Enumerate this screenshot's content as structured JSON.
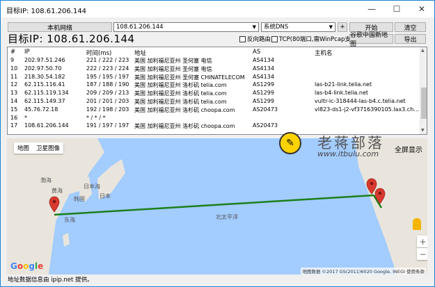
{
  "window": {
    "title": "目标IP: 108.61.206.144",
    "minimize": "—",
    "maximize": "☐",
    "close": "✕"
  },
  "toolbar": {
    "local_network_label": "本机网络",
    "target_value": "108.61.206.144",
    "dns_value": "系统DNS",
    "plus_label": "+",
    "start_label": "开始",
    "clear_label": "清空",
    "google_map_label": "谷歌中国新地图",
    "export_label": "导出",
    "reverse_route_label": "反向路由",
    "tcp_label": "TCP(80端口,需WinPcap支持)"
  },
  "big_target": "目标IP: 108.61.206.144",
  "table": {
    "headers": [
      "#",
      "IP",
      "时间(ms)",
      "地址",
      "AS",
      "主机名"
    ],
    "rows": [
      [
        "9",
        "202.97.51.246",
        "221 / 222 / 223",
        "美国 加利福尼亚州 圣何塞 电信",
        "AS4134",
        ""
      ],
      [
        "10",
        "202.97.50.70",
        "222 / 223 / 224",
        "美国 加利福尼亚州 圣何塞 电信",
        "AS4134",
        ""
      ],
      [
        "11",
        "218.30.54.182",
        "195 / 195 / 197",
        "美国 加利福尼亚州 圣何塞 CHINATELECOM",
        "AS4134",
        ""
      ],
      [
        "12",
        "62.115.116.41",
        "187 / 188 / 190",
        "美国 加利福尼亚州 洛杉矶 telia.com",
        "AS1299",
        "las-b21-link.telia.net"
      ],
      [
        "13",
        "62.115.119.134",
        "209 / 209 / 213",
        "美国 加利福尼亚州 洛杉矶 telia.com",
        "AS1299",
        "las-b4-link.telia.net"
      ],
      [
        "14",
        "62.115.149.37",
        "201 / 201 / 203",
        "美国 加利福尼亚州 洛杉矶 telia.com",
        "AS1299",
        "vultr-ic-318444-las-b4.c.telia.net"
      ],
      [
        "15",
        "45.76.72.18",
        "192 / 198 / 203",
        "美国 加利福尼亚州 洛杉矶 choopa.com",
        "AS20473",
        "vl823-ds1-j2-vf3716390105.lax3.ch..."
      ],
      [
        "16",
        "*",
        "* / * / *",
        "",
        "",
        ""
      ],
      [
        "17",
        "108.61.206.144",
        "191 / 197 / 197",
        "美国 加利福尼亚州 洛杉矶 choopa.com",
        "AS20473",
        ""
      ]
    ]
  },
  "map": {
    "tab_map": "地图",
    "tab_satellite": "卫星图像",
    "fullscreen": "全屏显示",
    "watermark_name": "老蒋部落",
    "watermark_url": "www.itbulu.com",
    "labels": {
      "korea": "韩国",
      "japan": "日本",
      "sea_japan": "日本海",
      "pacific": "北太平洋",
      "taiwan_sea": "东海",
      "yellow_sea": "黄海",
      "bohai": "渤海"
    },
    "zoom_in": "+",
    "zoom_out": "−",
    "attribution": "地图数据 ©2017 GS(2011)6020 Google, INEGI   使用条款",
    "google_letters": [
      "G",
      "o",
      "o",
      "g",
      "l",
      "e"
    ],
    "route_color": "#1a7f1a",
    "marker_color": "#d93a2f",
    "water_color": "#a3ccff",
    "land_color": "#e9e5dc"
  },
  "status": "地址数据信息由 ipip.net 提供。"
}
